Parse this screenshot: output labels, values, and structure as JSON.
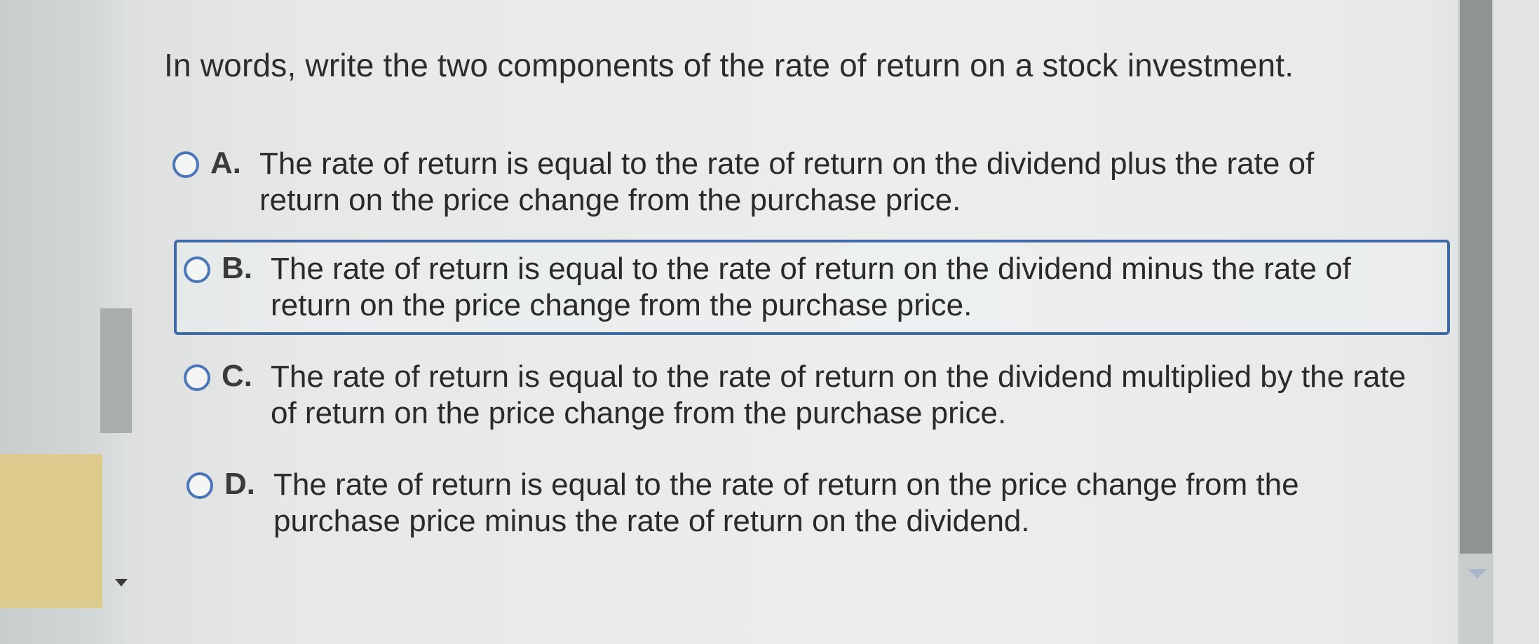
{
  "question": {
    "text": "In words, write the two components of the rate of return on a stock investment."
  },
  "options": [
    {
      "letter": "A.",
      "text": "The rate of return is equal to the rate of return on the dividend plus the rate of return on the price change from the purchase price.",
      "selected": false
    },
    {
      "letter": "B.",
      "text": "The rate of return is equal to the rate of return on the dividend minus the rate of return on the price change from the purchase price.",
      "selected": false
    },
    {
      "letter": "C.",
      "text": "The rate of return is equal to the rate of return on the dividend multiplied by the rate of return on the price change from the purchase price.",
      "selected": false
    },
    {
      "letter": "D.",
      "text": "The rate of return is equal to the rate of return on the price change from the purchase price minus the rate of return on the dividend.",
      "selected": false
    }
  ],
  "focused_option": "B.",
  "colors": {
    "radio_border": "#4b76b8",
    "focus_border": "#3f6aa6",
    "side_panel": "#dccb8d"
  }
}
